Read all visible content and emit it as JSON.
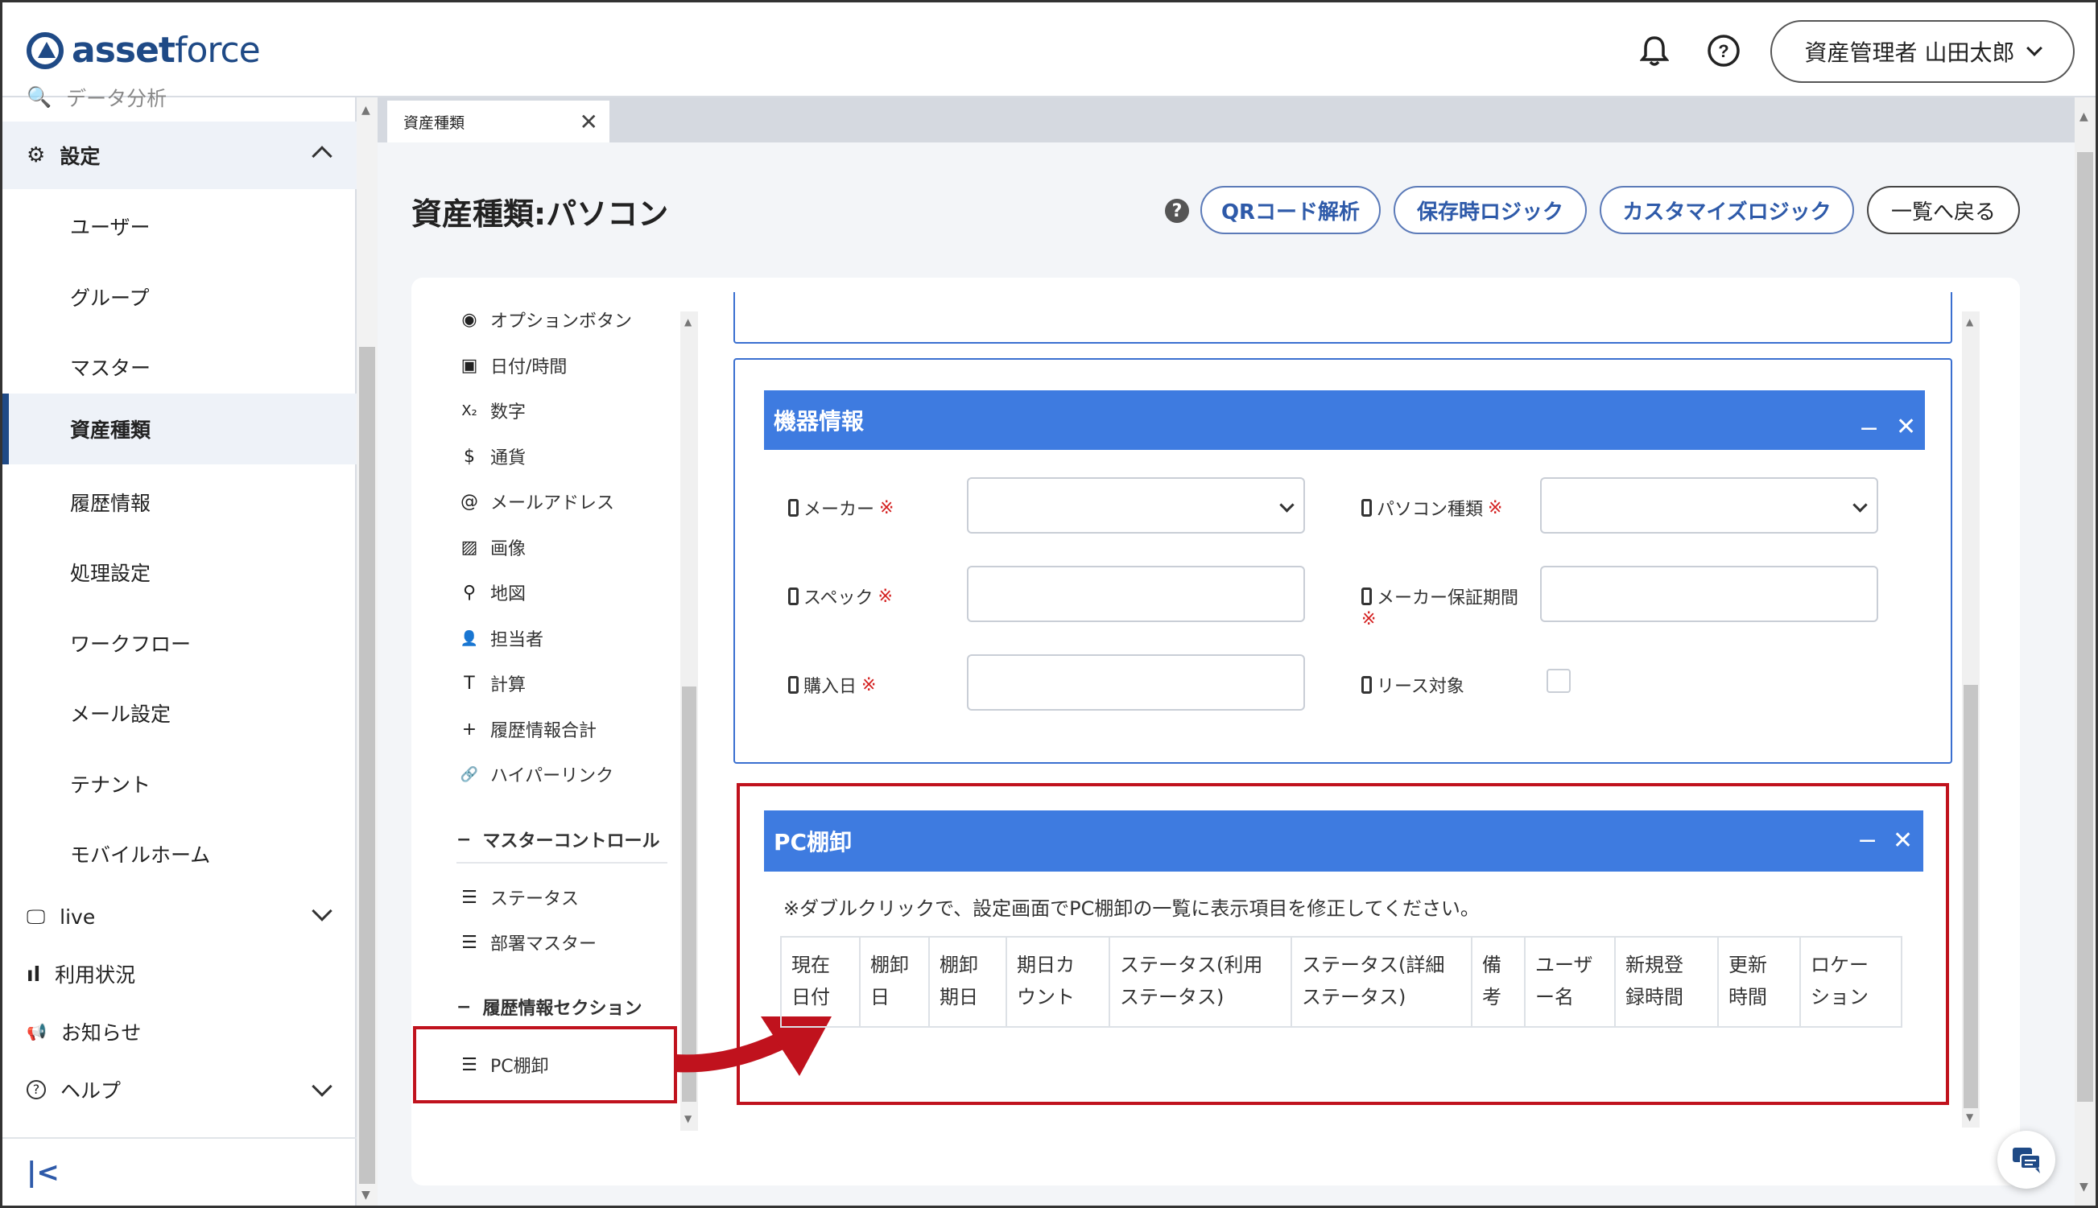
{
  "app": {
    "logo_bold": "asset",
    "logo_light": "force"
  },
  "header": {
    "user_label": "資産管理者 山田太郎"
  },
  "sidebar": {
    "cut_item": "データ分析",
    "settings": {
      "label": "設定"
    },
    "sub_items": [
      {
        "label": "ユーザー"
      },
      {
        "label": "グループ"
      },
      {
        "label": "マスター"
      },
      {
        "label": "資産種類"
      },
      {
        "label": "履歴情報"
      },
      {
        "label": "処理設定"
      },
      {
        "label": "ワークフロー"
      },
      {
        "label": "メール設定"
      },
      {
        "label": "テナント"
      },
      {
        "label": "モバイルホーム"
      }
    ],
    "bottom_items": [
      {
        "label": "live"
      },
      {
        "label": "利用状況"
      },
      {
        "label": "お知らせ"
      },
      {
        "label": "ヘルプ"
      }
    ],
    "collapse_icon": "collapse-left-icon"
  },
  "tab": {
    "label": "資産種類"
  },
  "page": {
    "title": "資産種類:パソコン"
  },
  "actions": {
    "qr": "QRコード解析",
    "save_logic": "保存時ロジック",
    "custom_logic": "カスタマイズロジック",
    "back": "一覧へ戻る"
  },
  "palette": {
    "items": [
      {
        "icon": "◉",
        "label": "オプションボタン"
      },
      {
        "icon": "▣",
        "label": "日付/時間"
      },
      {
        "icon": "X₂",
        "label": "数字"
      },
      {
        "icon": "$",
        "label": "通貨"
      },
      {
        "icon": "@",
        "label": "メールアドレス"
      },
      {
        "icon": "▨",
        "label": "画像"
      },
      {
        "icon": "⚲",
        "label": "地図"
      },
      {
        "icon": "👤",
        "label": "担当者"
      },
      {
        "icon": "T",
        "label": "計算"
      },
      {
        "icon": "+",
        "label": "履歴情報合計"
      },
      {
        "icon": "🔗",
        "label": "ハイパーリンク"
      }
    ],
    "master_section": "マスターコントロール",
    "master_items": [
      {
        "label": "ステータス"
      },
      {
        "label": "部署マスター"
      }
    ],
    "history_section": "履歴情報セクション",
    "history_items": [
      {
        "label": "PC棚卸"
      }
    ]
  },
  "device_section": {
    "title": "機器情報",
    "fields": {
      "maker": "メーカー",
      "pc_type": "パソコン種類",
      "spec": "スペック",
      "warranty": "メーカー保証期間",
      "purchase": "購入日",
      "lease": "リース対象"
    },
    "required_mark": "※"
  },
  "pc_section": {
    "title": "PC棚卸",
    "note": "※ダブルクリックで、設定画面でPC棚卸の一覧に表示項目を修正してください。",
    "columns": [
      {
        "line1": "現在",
        "line2": "日付"
      },
      {
        "line1": "棚卸",
        "line2": "日"
      },
      {
        "line1": "棚卸",
        "line2": "期日"
      },
      {
        "line1": "期日カ",
        "line2": "ウント"
      },
      {
        "line1": "ステータス(利用",
        "line2": "ステータス)"
      },
      {
        "line1": "ステータス(詳細",
        "line2": "ステータス)"
      },
      {
        "line1": "備",
        "line2": "考"
      },
      {
        "line1": "ユーザ",
        "line2": "ー名"
      },
      {
        "line1": "新規登",
        "line2": "録時間"
      },
      {
        "line1": "更新",
        "line2": "時間"
      },
      {
        "line1": "ロケー",
        "line2": "ション"
      }
    ]
  },
  "colors": {
    "brand": "#1f4a86",
    "section_header": "#3e7be0",
    "highlight": "#c0121d"
  }
}
